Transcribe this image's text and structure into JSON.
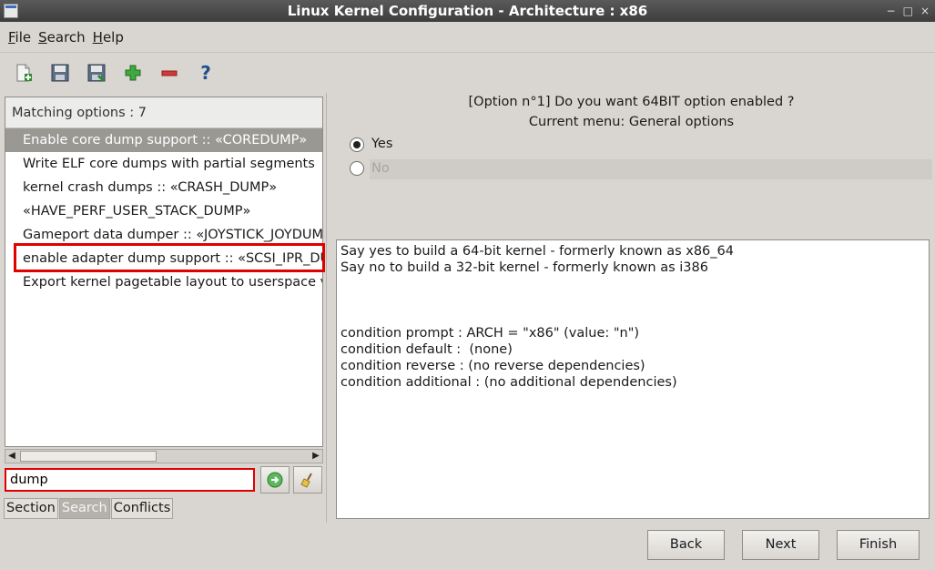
{
  "window": {
    "title": "Linux Kernel Configuration - Architecture : x86",
    "controls": [
      "−",
      "□",
      "×"
    ]
  },
  "menu": [
    {
      "label": "File",
      "key": "F",
      "rest": "ile"
    },
    {
      "label": "Search",
      "key": "S",
      "rest": "earch"
    },
    {
      "label": "Help",
      "key": "H",
      "rest": "elp"
    }
  ],
  "toolbar": {
    "icons": [
      "new-file-icon",
      "save-icon",
      "save-as-icon",
      "add-icon",
      "remove-icon",
      "help-icon"
    ],
    "help_glyph": "?"
  },
  "left_panel": {
    "header": "Matching options : 7",
    "items": [
      "Enable core dump support :: «COREDUMP»",
      "Write ELF core dumps with partial segments",
      "kernel crash dumps :: «CRASH_DUMP»",
      "«HAVE_PERF_USER_STACK_DUMP»",
      "Gameport data dumper :: «JOYSTICK_JOYDUMP»",
      "enable adapter dump support :: «SCSI_IPR_DUMP»",
      "Export kernel pagetable layout to userspace via debugfs"
    ],
    "selected_index": 0,
    "highlighted_index": 5
  },
  "search": {
    "value": "dump",
    "go_icon": "go-arrow-icon",
    "clear_icon": "broom-icon"
  },
  "tabs": [
    "Section",
    "Search",
    "Conflicts"
  ],
  "active_tab": "Search",
  "question": {
    "line1": "[Option n°1] Do you want 64BIT option enabled ?",
    "line2": "Current menu: General options",
    "options": [
      "Yes",
      "No"
    ],
    "selected": "Yes"
  },
  "help_text": [
    "Say yes to build a 64-bit kernel - formerly known as x86_64",
    "Say no to build a 32-bit kernel - formerly known as i386",
    "",
    "",
    "",
    "condition prompt : ARCH = \"x86\" (value: \"n\")",
    "condition default :  (none)",
    "condition reverse : (no reverse dependencies)",
    "condition additional : (no additional dependencies)"
  ],
  "buttons": {
    "back": "Back",
    "next": "Next",
    "finish": "Finish"
  },
  "colors": {
    "highlight_border": "#e00000",
    "selected_row": "#9a9893",
    "titlebar": "#4a4a4a"
  }
}
